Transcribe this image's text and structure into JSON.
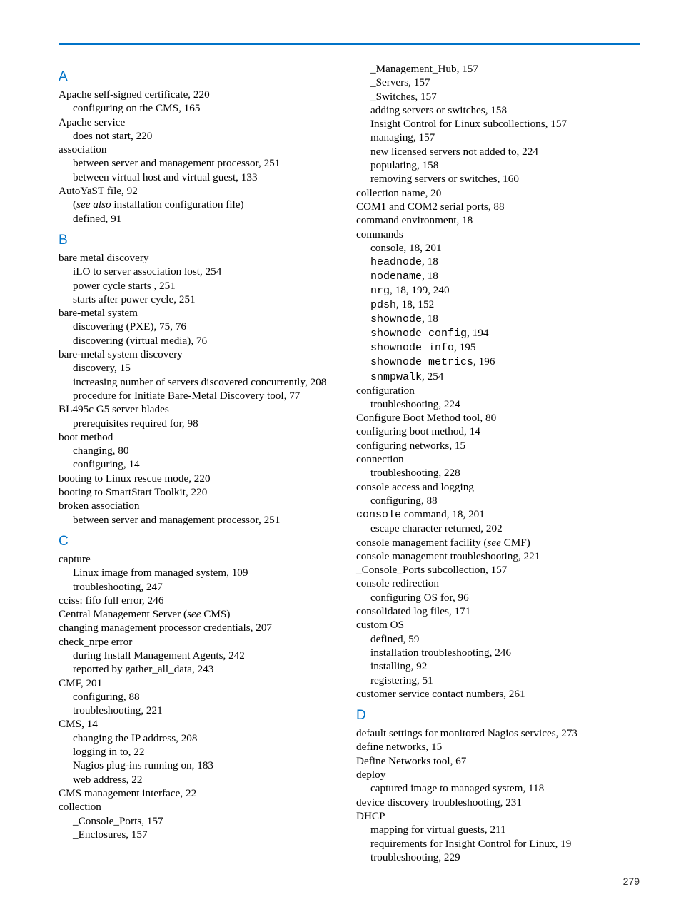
{
  "page_number": "279",
  "left": [
    {
      "type": "letter",
      "text": "A"
    },
    {
      "type": "entry",
      "text": "Apache self-signed certificate, 220"
    },
    {
      "type": "sub",
      "text": "configuring on the CMS, 165"
    },
    {
      "type": "entry",
      "text": "Apache service"
    },
    {
      "type": "sub",
      "text": "does not start, 220"
    },
    {
      "type": "entry",
      "text": "association"
    },
    {
      "type": "sub",
      "text": "between server and management processor, 251"
    },
    {
      "type": "sub",
      "text": "between virtual host and virtual guest, 133"
    },
    {
      "type": "entry",
      "text": "AutoYaST file, 92"
    },
    {
      "type": "sub",
      "html": "(<em>see also</em> installation configuration file)"
    },
    {
      "type": "sub",
      "text": "defined, 91"
    },
    {
      "type": "letter",
      "text": "B"
    },
    {
      "type": "entry",
      "text": "bare metal discovery"
    },
    {
      "type": "sub",
      "text": "iLO to server association lost, 254"
    },
    {
      "type": "sub",
      "text": "power cycle starts , 251"
    },
    {
      "type": "sub",
      "text": "starts after power cycle, 251"
    },
    {
      "type": "entry",
      "text": "bare-metal system"
    },
    {
      "type": "sub",
      "text": "discovering (PXE), 75, 76"
    },
    {
      "type": "sub",
      "text": "discovering (virtual media), 76"
    },
    {
      "type": "entry",
      "text": "bare-metal system discovery"
    },
    {
      "type": "sub",
      "text": "discovery, 15"
    },
    {
      "type": "sub",
      "text": "increasing number of servers discovered concurrently, 208"
    },
    {
      "type": "sub",
      "text": "procedure for Initiate Bare-Metal Discovery tool, 77"
    },
    {
      "type": "entry",
      "text": "BL495c G5 server blades"
    },
    {
      "type": "sub",
      "text": "prerequisites required for, 98"
    },
    {
      "type": "entry",
      "text": "boot method"
    },
    {
      "type": "sub",
      "text": "changing, 80"
    },
    {
      "type": "sub",
      "text": "configuring, 14"
    },
    {
      "type": "entry",
      "text": "booting to Linux rescue mode, 220"
    },
    {
      "type": "entry",
      "text": "booting to SmartStart Toolkit, 220"
    },
    {
      "type": "entry",
      "text": "broken association"
    },
    {
      "type": "sub",
      "text": "between server and management processor, 251"
    },
    {
      "type": "letter",
      "text": "C"
    },
    {
      "type": "entry",
      "text": "capture"
    },
    {
      "type": "sub",
      "text": "Linux image from managed system, 109"
    },
    {
      "type": "sub",
      "text": "troubleshooting, 247"
    },
    {
      "type": "entry",
      "text": "cciss: fifo full error, 246"
    },
    {
      "type": "entry",
      "html": "Central Management Server (<em>see</em> CMS)"
    },
    {
      "type": "entry",
      "text": "changing management processor credentials, 207"
    },
    {
      "type": "entry",
      "text": "check_nrpe error"
    },
    {
      "type": "sub",
      "text": "during Install Management Agents, 242"
    },
    {
      "type": "sub",
      "text": "reported by gather_all_data, 243"
    },
    {
      "type": "entry",
      "text": "CMF, 201"
    },
    {
      "type": "sub",
      "text": "configuring, 88"
    },
    {
      "type": "sub",
      "text": "troubleshooting, 221"
    },
    {
      "type": "entry",
      "text": "CMS, 14"
    },
    {
      "type": "sub",
      "text": "changing the IP address, 208"
    },
    {
      "type": "sub",
      "text": "logging in to, 22"
    },
    {
      "type": "sub",
      "text": "Nagios plug-ins running on, 183"
    },
    {
      "type": "sub",
      "text": "web address, 22"
    },
    {
      "type": "entry",
      "text": "CMS management interface, 22"
    },
    {
      "type": "entry",
      "text": "collection"
    },
    {
      "type": "sub",
      "text": "_Console_Ports, 157"
    },
    {
      "type": "sub",
      "text": "_Enclosures, 157"
    }
  ],
  "right": [
    {
      "type": "sub",
      "text": "_Management_Hub, 157"
    },
    {
      "type": "sub",
      "text": "_Servers, 157"
    },
    {
      "type": "sub",
      "text": "_Switches, 157"
    },
    {
      "type": "sub",
      "text": "adding servers or switches, 158"
    },
    {
      "type": "sub",
      "text": "Insight Control for Linux subcollections, 157"
    },
    {
      "type": "sub",
      "text": "managing, 157"
    },
    {
      "type": "sub",
      "text": "new licensed servers not added to, 224"
    },
    {
      "type": "sub",
      "text": "populating, 158"
    },
    {
      "type": "sub",
      "text": "removing servers or switches, 160"
    },
    {
      "type": "entry",
      "text": "collection name, 20"
    },
    {
      "type": "entry",
      "text": "COM1 and COM2 serial ports, 88"
    },
    {
      "type": "entry",
      "text": "command environment, 18"
    },
    {
      "type": "entry",
      "text": "commands"
    },
    {
      "type": "sub",
      "text": "console, 18, 201"
    },
    {
      "type": "sub",
      "html": "<span class='mono'>headnode</span>, 18"
    },
    {
      "type": "sub",
      "html": "<span class='mono'>nodename</span>, 18"
    },
    {
      "type": "sub",
      "html": "<span class='mono'>nrg</span>, 18, 199, 240"
    },
    {
      "type": "sub",
      "html": "<span class='mono'>pdsh</span>, 18, 152"
    },
    {
      "type": "sub",
      "html": "<span class='mono'>shownode</span>, 18"
    },
    {
      "type": "sub",
      "html": "<span class='mono'>shownode config</span>, 194"
    },
    {
      "type": "sub",
      "html": "<span class='mono'>shownode info</span>, 195"
    },
    {
      "type": "sub",
      "html": "<span class='mono'>shownode metrics</span>, 196"
    },
    {
      "type": "sub",
      "html": "<span class='mono'>snmpwalk</span>, 254"
    },
    {
      "type": "entry",
      "text": "configuration"
    },
    {
      "type": "sub",
      "text": "troubleshooting, 224"
    },
    {
      "type": "entry",
      "text": "Configure Boot Method tool, 80"
    },
    {
      "type": "entry",
      "text": "configuring boot method, 14"
    },
    {
      "type": "entry",
      "text": "configuring networks, 15"
    },
    {
      "type": "entry",
      "text": "connection"
    },
    {
      "type": "sub",
      "text": "troubleshooting, 228"
    },
    {
      "type": "entry",
      "text": "console access and logging"
    },
    {
      "type": "sub",
      "text": "configuring, 88"
    },
    {
      "type": "entry",
      "html": "<span class='mono'>console</span> command, 18, 201"
    },
    {
      "type": "sub",
      "text": "escape character returned, 202"
    },
    {
      "type": "entry",
      "html": "console management facility (<em>see</em> CMF)"
    },
    {
      "type": "entry",
      "text": "console management troubleshooting, 221"
    },
    {
      "type": "entry",
      "text": "_Console_Ports subcollection, 157"
    },
    {
      "type": "entry",
      "text": "console redirection"
    },
    {
      "type": "sub",
      "text": "configuring OS for, 96"
    },
    {
      "type": "entry",
      "text": "consolidated log files, 171"
    },
    {
      "type": "entry",
      "text": "custom OS"
    },
    {
      "type": "sub",
      "text": "defined, 59"
    },
    {
      "type": "sub",
      "text": "installation troubleshooting, 246"
    },
    {
      "type": "sub",
      "text": "installing, 92"
    },
    {
      "type": "sub",
      "text": "registering, 51"
    },
    {
      "type": "entry",
      "text": "customer service contact numbers, 261"
    },
    {
      "type": "letter",
      "text": "D"
    },
    {
      "type": "entry",
      "text": "default settings for monitored Nagios services, 273"
    },
    {
      "type": "entry",
      "text": "define networks, 15"
    },
    {
      "type": "entry",
      "text": "Define Networks tool, 67"
    },
    {
      "type": "entry",
      "text": "deploy"
    },
    {
      "type": "sub",
      "text": "captured image to managed system, 118"
    },
    {
      "type": "entry",
      "text": "device discovery troubleshooting, 231"
    },
    {
      "type": "entry",
      "text": "DHCP"
    },
    {
      "type": "sub",
      "text": "mapping for virtual guests, 211"
    },
    {
      "type": "sub",
      "text": "requirements for Insight Control for Linux, 19"
    },
    {
      "type": "sub",
      "text": "troubleshooting, 229"
    }
  ]
}
